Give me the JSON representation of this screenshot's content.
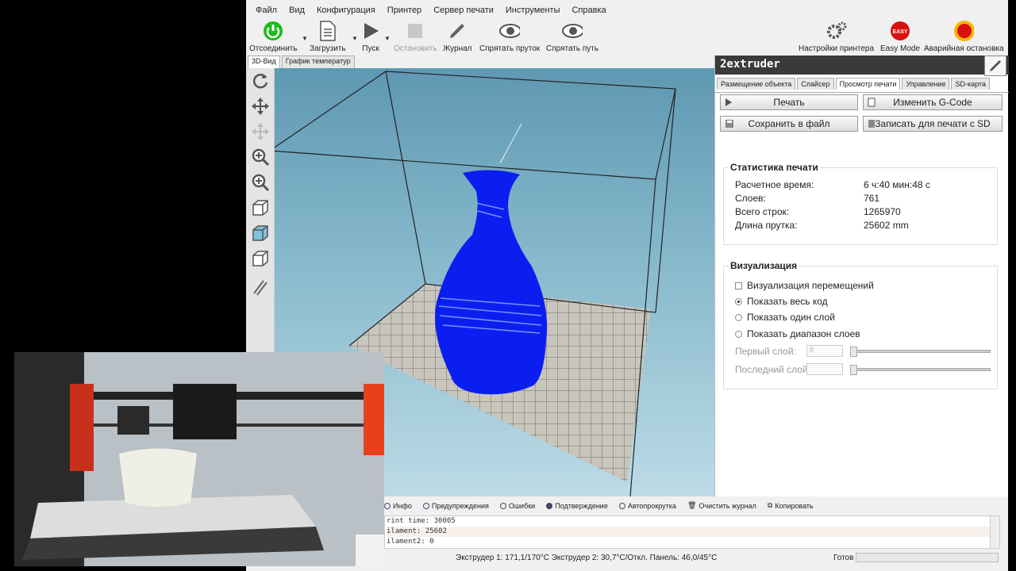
{
  "menu": [
    "Файл",
    "Вид",
    "Конфигурация",
    "Принтер",
    "Сервер печати",
    "Инструменты",
    "Справка"
  ],
  "toolbar": {
    "disconnect": "Отсоединить",
    "load": "Загрузить",
    "start": "Пуск",
    "stop": "Остановить",
    "log": "Журнал",
    "hide_filament": "Спрятать пруток",
    "hide_travel": "Спрятать путь",
    "printer_settings": "Настройки принтера",
    "easy_mode": "Easy Mode",
    "easy_badge": "EASY",
    "emergency": "Аварийная остановка"
  },
  "view_tabs": [
    "3D-Вид",
    "График температур"
  ],
  "panel": {
    "title": "2extruder",
    "tabs": [
      "Размещение объекта",
      "Слайсер",
      "Просмотр печати",
      "Управление",
      "SD-карта"
    ],
    "print_btn": "Печать",
    "edit_gcode_btn": "Изменить G-Code",
    "save_file_btn": "Сохранить в файл",
    "write_sd_btn": "Записать для печати с SD",
    "stats": {
      "title": "Статистика печати",
      "rows": [
        {
          "label": "Расчетное время:",
          "value": "6 ч:40 мин:48 с"
        },
        {
          "label": "Слоев:",
          "value": "761"
        },
        {
          "label": "Всего строк:",
          "value": "1265970"
        },
        {
          "label": "Длина прутка:",
          "value": "25602 mm"
        }
      ]
    },
    "visual": {
      "title": "Визуализация",
      "travel": "Визуализация перемещений",
      "all_code": "Показать весь код",
      "one_layer": "Показать один слой",
      "layer_range": "Показать диапазон слоев",
      "first_layer": "Первый слой:",
      "first_value": "0",
      "last_layer": "Последний слой:"
    }
  },
  "log_tabs": [
    "Инфо",
    "Предупреждения",
    "Ошибки",
    "Подтверждение",
    "Автопрокрутка",
    "Очистить журнал",
    "Копировать"
  ],
  "log_lines": [
    "rint time: 30005",
    "ilament: 25602",
    "ilament2: 0"
  ],
  "status": {
    "temps": "Экструдер 1: 171,1/170°C Экструдер 2: 30,7°C/Откл. Панель: 46,0/45°C",
    "ready": "Готов"
  },
  "colors": {
    "model": "#0b1ef0",
    "viewport_top": "#5f98b2",
    "emergency": "#d81010",
    "connect": "#1dbb1d"
  }
}
